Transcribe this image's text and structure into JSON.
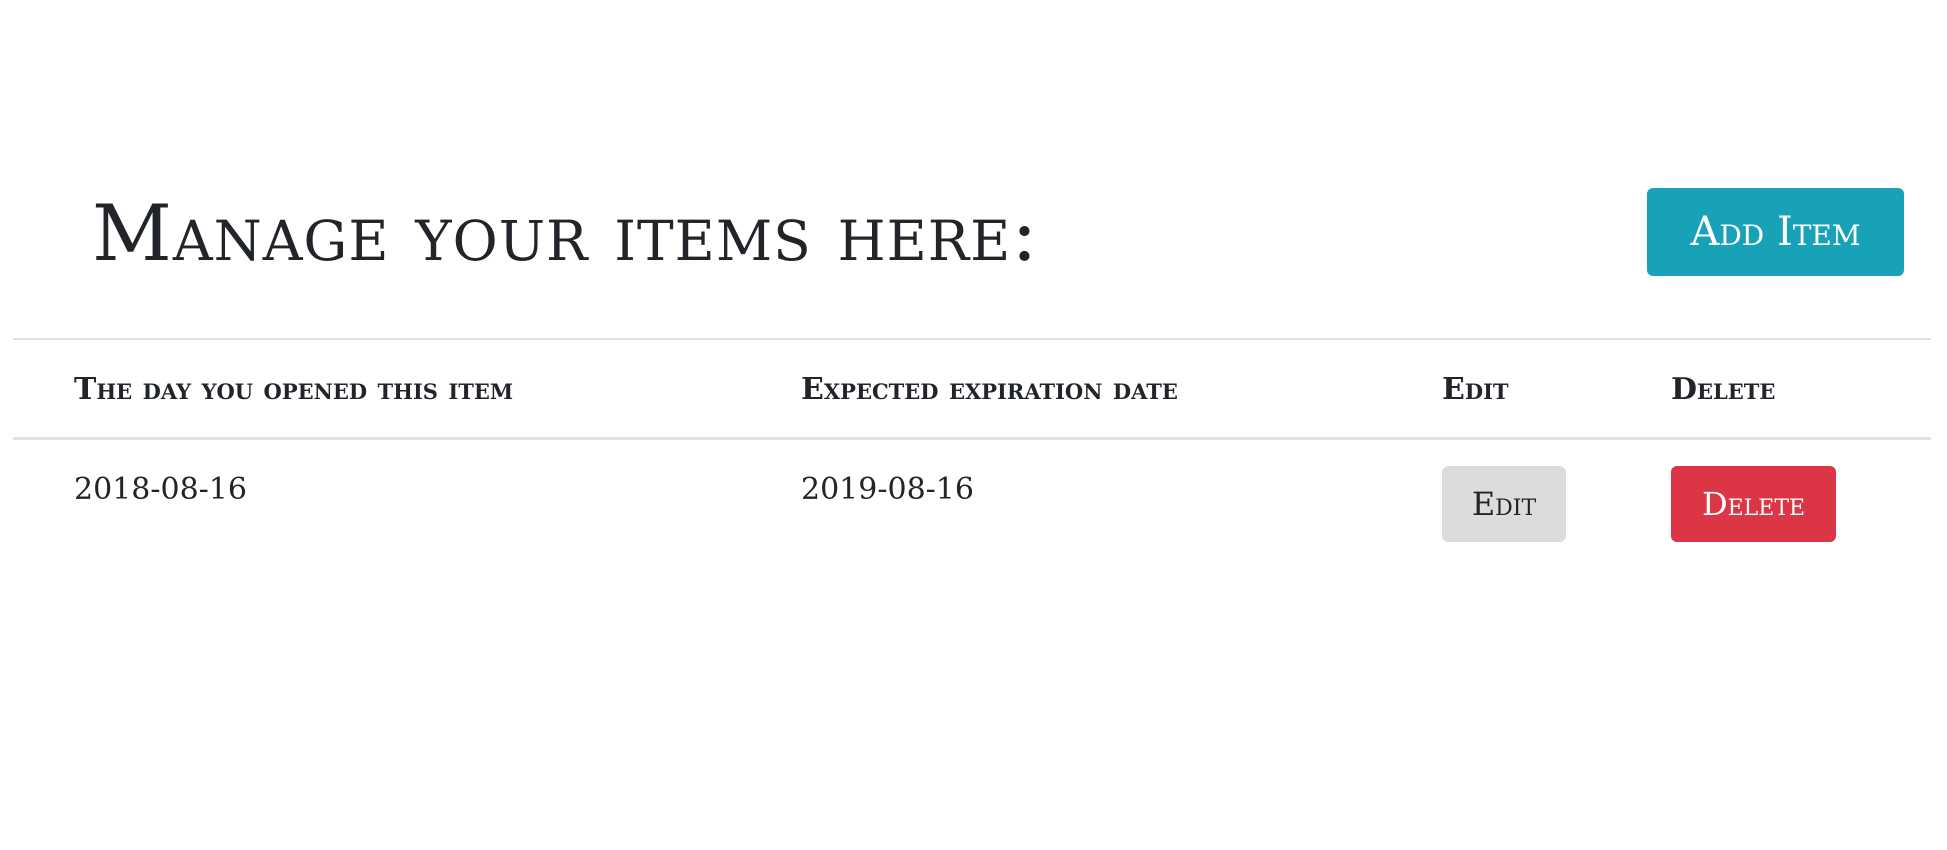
{
  "header": {
    "title": "Manage your items here:",
    "add_button_label": "Add Item"
  },
  "table": {
    "columns": [
      "The day you opened this item",
      "Expected expiration date",
      "Edit",
      "Delete"
    ],
    "rows": [
      {
        "opened": "2018-08-16",
        "expires": "2019-08-16",
        "edit_label": "Edit",
        "delete_label": "Delete"
      }
    ]
  },
  "colors": {
    "accent": "#17a2b8",
    "danger": "#dc3545",
    "secondary": "#dcdcdc",
    "text": "#212529",
    "rule": "#dee2e6"
  }
}
